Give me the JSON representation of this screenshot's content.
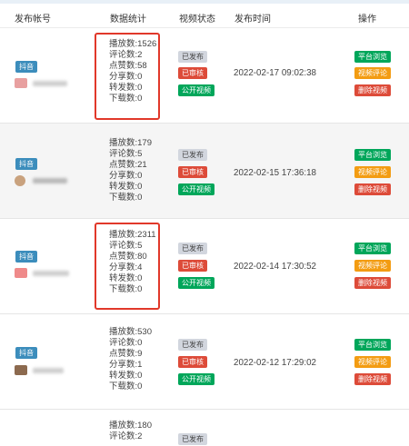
{
  "header": {
    "account": "发布帐号",
    "stats": "数据统计",
    "status": "视频状态",
    "time": "发布时间",
    "ops": "操作"
  },
  "rows": [
    {
      "platform": "抖音",
      "avatar_color": "#e8a0a0",
      "stats": [
        "播放数:1526",
        "评论数:2",
        "点赞数:58",
        "分享数:0",
        "转发数:0",
        "下载数:0"
      ],
      "status": [
        "已发布",
        "已审核",
        "公开视频"
      ],
      "time": "2022-02-17 09:02:38",
      "ops": [
        "平台浏览",
        "视频评论",
        "删除视频"
      ],
      "highlighted": true
    },
    {
      "platform": "抖音",
      "avatar_color": "#c9a27e",
      "stats": [
        "播放数:179",
        "评论数:5",
        "点赞数:21",
        "分享数:0",
        "转发数:0",
        "下载数:0"
      ],
      "status": [
        "已发布",
        "已审核",
        "公开视频"
      ],
      "time": "2022-02-15 17:36:18",
      "ops": [
        "平台浏览",
        "视频评论",
        "删除视频"
      ],
      "highlighted": false
    },
    {
      "platform": "抖音",
      "avatar_color": "#ef8a8a",
      "stats": [
        "播放数:2311",
        "评论数:5",
        "点赞数:80",
        "分享数:4",
        "转发数:0",
        "下载数:0"
      ],
      "status": [
        "已发布",
        "已审核",
        "公开视频"
      ],
      "time": "2022-02-14 17:30:52",
      "ops": [
        "平台浏览",
        "视频评论",
        "删除视频"
      ],
      "highlighted": true
    },
    {
      "platform": "抖音",
      "avatar_color": "#8c6a4f",
      "stats": [
        "播放数:530",
        "评论数:0",
        "点赞数:9",
        "分享数:1",
        "转发数:0",
        "下载数:0"
      ],
      "status": [
        "已发布",
        "已审核",
        "公开视频"
      ],
      "time": "2022-02-12 17:29:02",
      "ops": [
        "平台浏览",
        "视频评论",
        "删除视频"
      ],
      "highlighted": false
    },
    {
      "platform": "",
      "avatar_color": "",
      "stats": [
        "播放数:180",
        "评论数:2",
        "",
        "",
        "",
        ""
      ],
      "status": [
        "已发布",
        "",
        ""
      ],
      "time": "",
      "ops": [
        "",
        "",
        ""
      ],
      "highlighted": false
    }
  ]
}
